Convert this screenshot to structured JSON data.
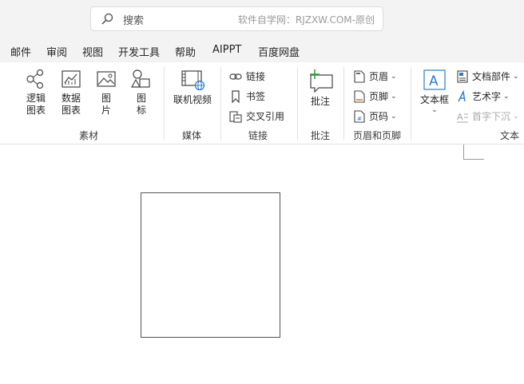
{
  "search": {
    "placeholder": "搜索",
    "watermark": "软件自学网：RJZXW.COM-原创"
  },
  "tabs": [
    "邮件",
    "审阅",
    "视图",
    "开发工具",
    "帮助",
    "AIPPT",
    "百度网盘"
  ],
  "ribbon": {
    "groups": {
      "sucai": "素材",
      "meiti": "媒体",
      "lianjie": "链接",
      "pizhu": "批注",
      "yemei": "页眉和页脚",
      "wenben": "文本"
    },
    "sucai": {
      "logic_l1": "逻辑",
      "logic_l2": "图表",
      "data_l1": "数据",
      "data_l2": "图表",
      "pic_l1": "图",
      "pic_l2": "片",
      "icon_l1": "图",
      "icon_l2": "标"
    },
    "meiti": {
      "online_video": "联机视频"
    },
    "lianjie": {
      "link": "链接",
      "bookmark": "书签",
      "crossref": "交叉引用"
    },
    "pizhu": {
      "comment": "批注"
    },
    "yemei": {
      "header": "页眉",
      "footer": "页脚",
      "pagenum": "页码"
    },
    "wenben": {
      "textbox": "文本框",
      "docparts": "文档部件",
      "wordart": "艺术字",
      "dropcap": "首字下沉"
    }
  },
  "colors": {
    "accent": "#2b7cd3",
    "ribbon_bg": "#f3f3f3",
    "green": "#3a9b45"
  }
}
